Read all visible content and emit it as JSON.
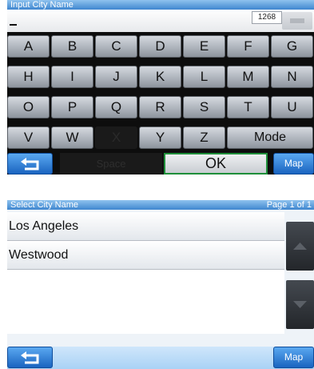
{
  "keyboard_screen": {
    "title": "Input City Name",
    "input": {
      "value": "",
      "counter": "1268"
    },
    "rows": [
      [
        {
          "label": "A",
          "enabled": true
        },
        {
          "label": "B",
          "enabled": true
        },
        {
          "label": "C",
          "enabled": true
        },
        {
          "label": "D",
          "enabled": true
        },
        {
          "label": "E",
          "enabled": true
        },
        {
          "label": "F",
          "enabled": true
        },
        {
          "label": "G",
          "enabled": true
        }
      ],
      [
        {
          "label": "H",
          "enabled": true
        },
        {
          "label": "I",
          "enabled": true
        },
        {
          "label": "J",
          "enabled": true
        },
        {
          "label": "K",
          "enabled": true
        },
        {
          "label": "L",
          "enabled": true
        },
        {
          "label": "M",
          "enabled": true
        },
        {
          "label": "N",
          "enabled": true
        }
      ],
      [
        {
          "label": "O",
          "enabled": true
        },
        {
          "label": "P",
          "enabled": true
        },
        {
          "label": "Q",
          "enabled": true
        },
        {
          "label": "R",
          "enabled": true
        },
        {
          "label": "S",
          "enabled": true
        },
        {
          "label": "T",
          "enabled": true
        },
        {
          "label": "U",
          "enabled": true
        }
      ],
      [
        {
          "label": "V",
          "enabled": true
        },
        {
          "label": "W",
          "enabled": true
        },
        {
          "label": "X",
          "enabled": false
        },
        {
          "label": "Y",
          "enabled": true
        },
        {
          "label": "Z",
          "enabled": true
        }
      ]
    ],
    "mode_label": "Mode",
    "space_label": "Space",
    "ok_label": "OK",
    "map_label": "Map",
    "back_icon": "back-arrow-icon",
    "backspace_icon": "backspace-icon"
  },
  "list_screen": {
    "title": "Select City Name",
    "page_info": "Page 1 of 1",
    "cities": [
      "Los Angeles",
      "Westwood"
    ],
    "map_label": "Map",
    "back_icon": "back-arrow-icon",
    "scroll_up_icon": "triangle-up-icon",
    "scroll_down_icon": "triangle-down-icon"
  },
  "colors": {
    "title_bar": "#3f86cf",
    "key_face": "#aeb4bc",
    "ok_border": "#1f8f3a",
    "blue_button": "#1a64c0",
    "list_background": "#ffffff"
  }
}
